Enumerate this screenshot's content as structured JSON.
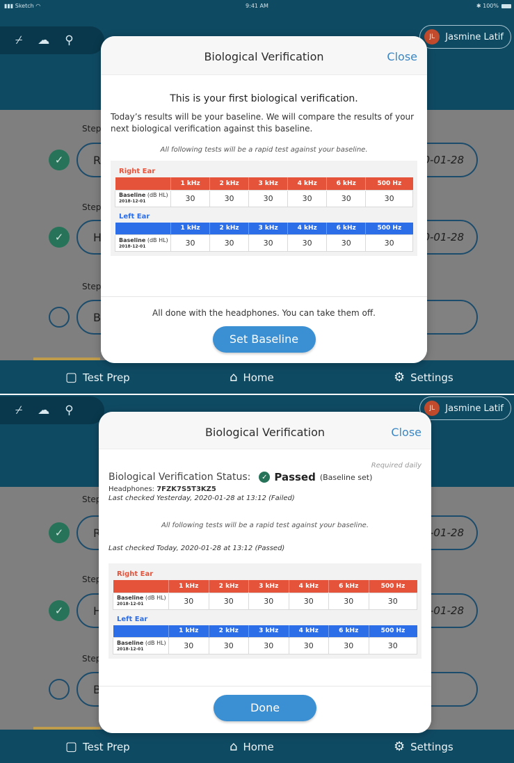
{
  "status": {
    "carrier": "Sketch",
    "time": "9:41 AM",
    "battery": "100%"
  },
  "user": {
    "initials": "JL",
    "name": "Jasmine Latif"
  },
  "toolbar_icons": [
    "wifi-off-icon",
    "cloud-upload-icon",
    "usb-icon"
  ],
  "steps": {
    "label": "Step",
    "rows": [
      {
        "state": "done",
        "first_letter": "R",
        "date": "0-01-28"
      },
      {
        "state": "done",
        "first_letter": "H",
        "date": "0-01-28"
      },
      {
        "state": "todo",
        "first_letter": "B",
        "date": ""
      }
    ]
  },
  "tabbar": {
    "test_prep": "Test Prep",
    "home": "Home",
    "settings": "Settings"
  },
  "modal1": {
    "title": "Biological Verification",
    "close": "Close",
    "heading": "This is your first biological verification.",
    "body": "Today’s results will be your baseline.  We will compare the results of your next biological verification against this baseline.",
    "note": "All following tests will be a rapid test against your baseline.",
    "footer_text": "All done with the headphones. You can take them off.",
    "button": "Set Baseline"
  },
  "modal2": {
    "title": "Biological Verification",
    "close": "Close",
    "required": "Required daily",
    "status_label": "Biological Verification Status:",
    "status_value": "Passed",
    "status_note": "(Baseline set)",
    "headphones_label": "Headphones:",
    "headphones_id": "7FZK7S5T3KZ5",
    "last_checked_prev": "Last checked Yesterday, 2020-01-28 at 13:12 (Failed)",
    "note": "All following tests will be a rapid test against your baseline.",
    "last_checked_today": "Last checked Today, 2020-01-28 at 13:12 (Passed)",
    "button": "Done"
  },
  "audiogram": {
    "right_label": "Right Ear",
    "left_label": "Left Ear",
    "freqs": [
      "1 kHz",
      "2 kHz",
      "3 kHz",
      "4 kHz",
      "6 kHz",
      "500 Hz"
    ],
    "row_label": "Baseline",
    "row_unit": "(dB HL)",
    "row_date": "2018-12-01",
    "right_values": [
      "30",
      "30",
      "30",
      "30",
      "30",
      "30"
    ],
    "left_values": [
      "30",
      "30",
      "30",
      "30",
      "30",
      "30"
    ]
  },
  "colors": {
    "right_ear": "#e5533b",
    "left_ear": "#2b6ee8",
    "accent": "#3b8fd3",
    "passed": "#27735a"
  }
}
